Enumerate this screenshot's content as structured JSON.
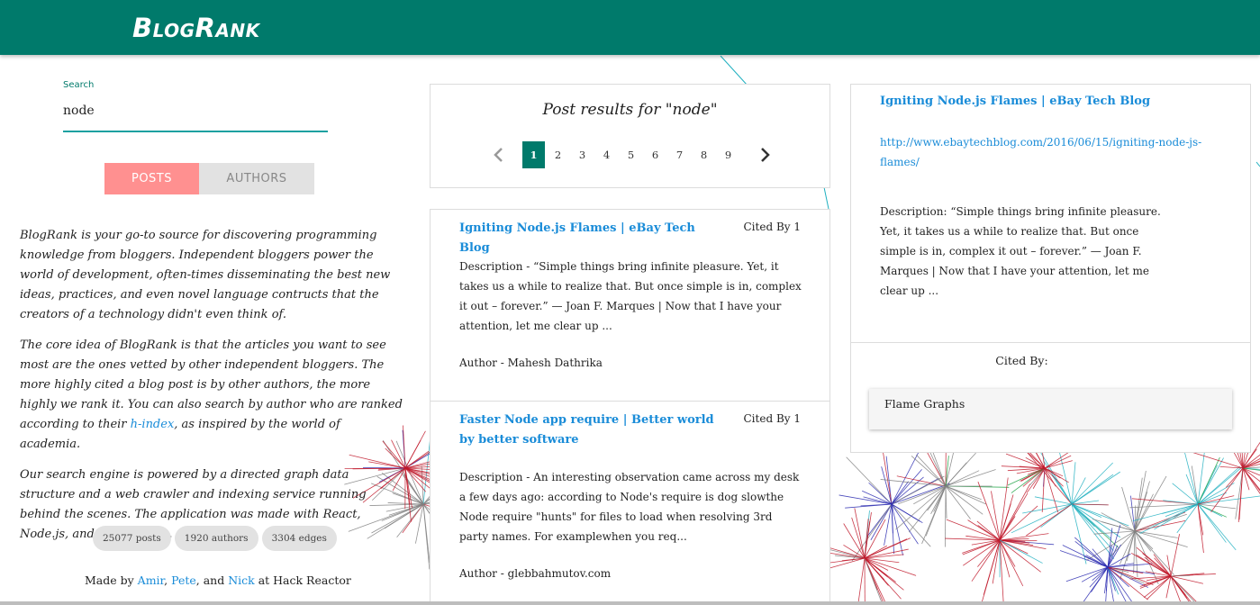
{
  "header": {
    "logo": "BlogRank"
  },
  "search": {
    "label": "Search",
    "value": "node"
  },
  "toggle": {
    "posts": "POSTS",
    "authors": "AUTHORS"
  },
  "about": {
    "p1": "BlogRank is your go-to source for discovering programming knowledge from bloggers. Independent bloggers power the world of development, often-times disseminating the best new ideas, practices, and even novel language contructs that the creators of a technology didn't even think of.",
    "p2_before": "The core idea of BlogRank is that the articles you want to see most are the ones vetted by other independent bloggers. The more highly cited a blog post is by other authors, the more highly we rank it. You can also search by author who are ranked according to their ",
    "p2_link": "h-index",
    "p2_after": ", as inspired by the world of academia.",
    "p3": "Our search engine is powered by a directed graph data structure and a web crawler and indexing service running behind the scenes. The application was made with React, Node.js, and postgreSQL."
  },
  "stats": {
    "posts": "25077 posts",
    "authors": "1920 authors",
    "edges": "3304 edges"
  },
  "credits": {
    "prefix": "Made by ",
    "amir": "Amir",
    "sep1": ", ",
    "pete": "Pete",
    "sep2": ", and ",
    "nick": "Nick",
    "suffix": " at Hack Reactor"
  },
  "results": {
    "title": "Post results for \"node\"",
    "pages": [
      "1",
      "2",
      "3",
      "4",
      "5",
      "6",
      "7",
      "8",
      "9"
    ],
    "active_page": "1",
    "items": [
      {
        "title": "Igniting Node.js Flames | eBay Tech Blog",
        "cited": "Cited By 1",
        "description": "Description - “Simple things bring infinite pleasure. Yet, it takes us a while to realize that. But once simple is in, complex it out – forever.” — Joan F. Marques | Now that I have your attention, let me clear up ...",
        "author": "Author - Mahesh Dathrika"
      },
      {
        "title": "Faster Node app require | Better world by better software",
        "cited": "Cited By 1",
        "description": "Description - An interesting observation came across my desk a few days ago: according to Node's require is dog slowthe Node require \"hunts\" for files to load when resolving 3rd party names. For examplewhen you req...",
        "author": "Author - glebbahmutov.com"
      }
    ]
  },
  "detail": {
    "title": "Igniting Node.js Flames | eBay Tech Blog",
    "url": "http://www.ebaytechblog.com/2016/06/15/igniting-node-js-flames/",
    "description": "Description: “Simple things bring infinite pleasure. Yet, it takes us a while to realize that. But once simple is in, complex it out – forever.” — Joan F. Marques | Now that I have your attention, let me clear up ...",
    "cited_by_label": "Cited By:",
    "cited_by": [
      "Flame Graphs"
    ]
  },
  "icons": {
    "prev": "chevron-left-icon",
    "next": "chevron-right-icon"
  },
  "colors": {
    "header": "#007a6b",
    "posts_active": "#ff9090",
    "link": "#1a8cd8",
    "accent": "#1aa0a0"
  }
}
